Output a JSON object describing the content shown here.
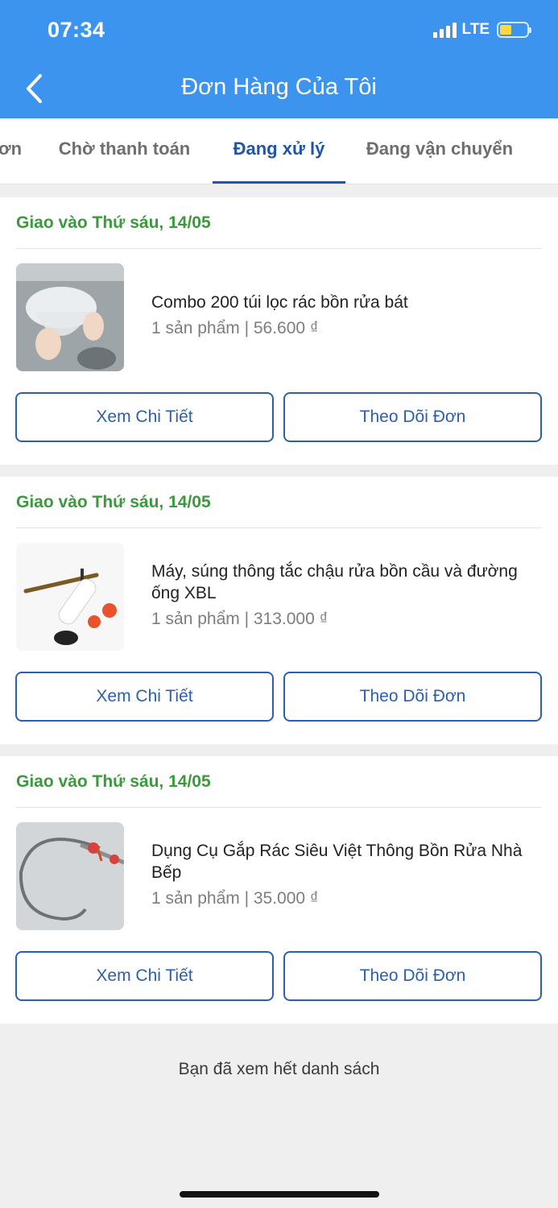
{
  "status_bar": {
    "time": "07:34",
    "network": "LTE"
  },
  "header": {
    "title": "Đơn Hàng Của Tôi",
    "back_icon": "chevron-left-icon"
  },
  "tabs": [
    {
      "label": "ơn"
    },
    {
      "label": "Chờ thanh toán"
    },
    {
      "label": "Đang xử lý",
      "active": true
    },
    {
      "label": "Đang vận chuyển"
    }
  ],
  "orders": [
    {
      "delivery": "Giao vào Thứ sáu, 14/05",
      "product_name": "Combo 200 túi lọc rác bồn rửa bát",
      "meta": "1 sản phẩm | 56.600 ₫",
      "detail_label": "Xem Chi Tiết",
      "track_label": "Theo Dõi Đơn"
    },
    {
      "delivery": "Giao vào Thứ sáu, 14/05",
      "product_name": "Máy, súng thông tắc chậu rửa bồn cầu và đường ống XBL",
      "meta": "1 sản phẩm | 313.000 ₫",
      "detail_label": "Xem Chi Tiết",
      "track_label": "Theo Dõi Đơn"
    },
    {
      "delivery": "Giao vào Thứ sáu, 14/05",
      "product_name": "Dụng Cụ Gắp Rác Siêu Việt Thông Bồn Rửa Nhà Bếp",
      "meta": "1 sản phẩm | 35.000 ₫",
      "detail_label": "Xem Chi Tiết",
      "track_label": "Theo Dõi Đơn"
    }
  ],
  "footer": {
    "end_text": "Bạn đã xem hết danh sách"
  },
  "colors": {
    "header": "#3d94ee",
    "accent": "#1f55ab",
    "delivery": "#3b9a3b"
  }
}
